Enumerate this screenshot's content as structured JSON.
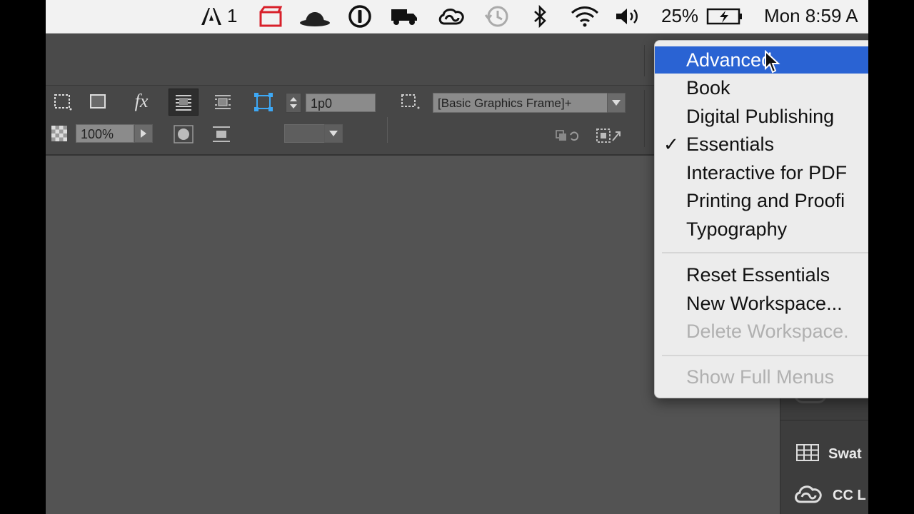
{
  "menubar": {
    "adobe_badge": "1",
    "battery_percent": "25%",
    "clock": "Mon 8:59 A"
  },
  "toolbar": {
    "fx_label": "fx",
    "opacity_value": "100%",
    "stroke_value": "1p0",
    "object_style": "[Basic Graphics Frame]+"
  },
  "panels": {
    "swatches_label": "Swat",
    "cc_libraries_label": "CC L"
  },
  "workspace_menu": {
    "items": [
      {
        "label": "Advanced",
        "highlighted": true
      },
      {
        "label": "Book"
      },
      {
        "label": "Digital Publishing"
      },
      {
        "label": "Essentials",
        "checked": true,
        "checkmark": "✓"
      },
      {
        "label": "Interactive for PDF"
      },
      {
        "label": "Printing and Proofi"
      },
      {
        "label": "Typography"
      }
    ],
    "actions": [
      {
        "label": "Reset Essentials"
      },
      {
        "label": "New Workspace..."
      },
      {
        "label": "Delete Workspace.",
        "disabled": true
      }
    ],
    "footer": {
      "label": "Show Full Menus",
      "disabled": true
    }
  },
  "colors": {
    "menu_highlight": "#2a63d3",
    "canvas": "#535353",
    "menubar": "#f2f2f2"
  }
}
